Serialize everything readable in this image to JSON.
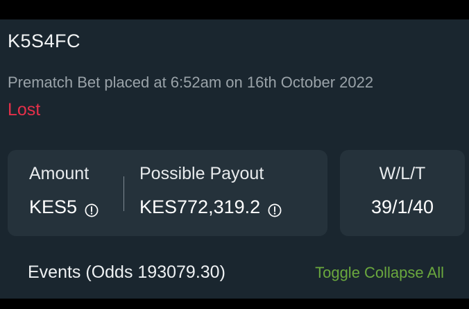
{
  "bet": {
    "id": "K5S4FC",
    "placed_text": "Prematch Bet placed at 6:52am on 16th October 2022",
    "status": "Lost"
  },
  "summary": {
    "amount_label": "Amount",
    "amount_value": "KES5",
    "payout_label": "Possible Payout",
    "payout_value": "KES772,319.2",
    "wlt_label": "W/L/T",
    "wlt_value": "39/1/40"
  },
  "events": {
    "title": "Events (Odds 193079.30)",
    "toggle_label": "Toggle Collapse All"
  },
  "icons": {
    "amount_info": "info-circle-icon",
    "payout_info": "info-circle-icon"
  },
  "colors": {
    "background": "#1a262f",
    "card": "#25323b",
    "status_lost": "#e5304a",
    "toggle": "#6aa83e"
  }
}
